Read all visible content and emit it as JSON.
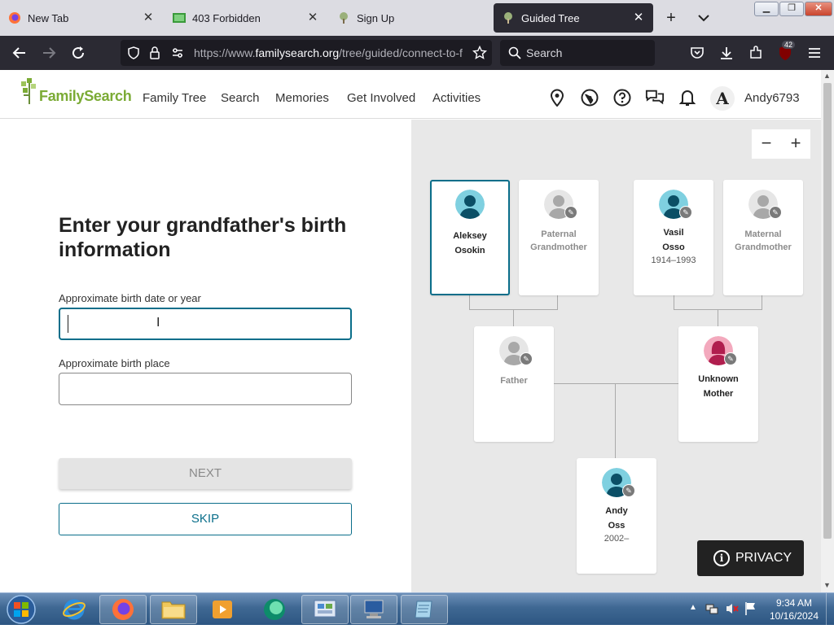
{
  "browser": {
    "tabs": [
      {
        "title": "New Tab",
        "icon": "firefox-icon",
        "active": false
      },
      {
        "title": "403 Forbidden",
        "icon": "tab-image-icon",
        "active": false
      },
      {
        "title": "Sign Up",
        "icon": "tree-icon",
        "active": false
      },
      {
        "title": "Guided Tree",
        "icon": "tree-icon",
        "active": true
      }
    ],
    "url_prefix": "https://www.",
    "url_domain": "familysearch.org",
    "url_path": "/tree/guided/connect-to-f",
    "search_placeholder": "Search",
    "extension_badge": "42"
  },
  "site": {
    "logo_text": "FamilySearch",
    "nav": [
      "Family Tree",
      "Search",
      "Memories",
      "Get Involved",
      "Activities"
    ],
    "avatar_letter": "A",
    "username": "Andy6793"
  },
  "form": {
    "heading": "Enter your grandfather's birth information",
    "birth_date_label": "Approximate birth date or year",
    "birth_date_value": "",
    "birth_place_label": "Approximate birth place",
    "birth_place_value": "",
    "next_label": "NEXT",
    "skip_label": "SKIP"
  },
  "tree": {
    "zoom_out": "−",
    "zoom_in": "+",
    "people": {
      "aleksey": {
        "name_line1": "Aleksey",
        "name_line2": "Osokin",
        "years": ""
      },
      "paternal_grandmother": {
        "name_line1": "Paternal",
        "name_line2": "Grandmother",
        "years": ""
      },
      "vasil": {
        "name_line1": "Vasil",
        "name_line2": "Osso",
        "years": "1914–1993"
      },
      "maternal_grandmother": {
        "name_line1": "Maternal",
        "name_line2": "Grandmother",
        "years": ""
      },
      "father": {
        "name_line1": "Father",
        "name_line2": "",
        "years": ""
      },
      "mother": {
        "name_line1": "Unknown",
        "name_line2": "Mother",
        "years": ""
      },
      "andy": {
        "name_line1": "Andy",
        "name_line2": "Oss",
        "years": "2002–"
      }
    }
  },
  "privacy_label": "PRIVACY",
  "taskbar": {
    "time": "9:34 AM",
    "date": "10/16/2024"
  },
  "colors": {
    "accent": "#0a6e8a",
    "logo_green": "#7bab35",
    "male_avatar": "#0b6f8e",
    "female_avatar": "#b01e4e"
  }
}
